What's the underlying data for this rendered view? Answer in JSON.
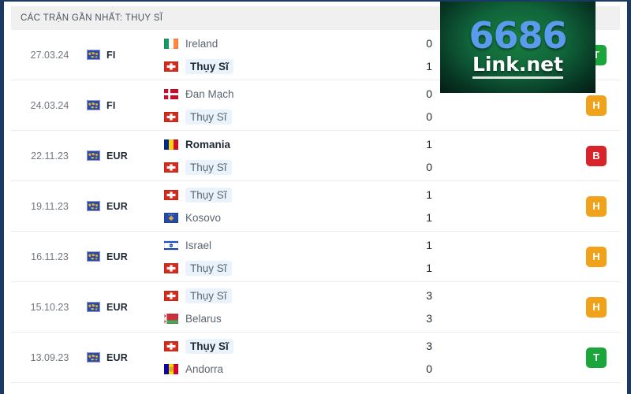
{
  "header": {
    "title": "CÁC TRẬN GẦN NHẤT: THỤY SĨ"
  },
  "colors": {
    "win_badge": "#1aa63a",
    "draw_badge": "#f0a21a",
    "loss_badge": "#d8232a",
    "header_bg": "#f0f0f0",
    "panel_border": "#1b3a63",
    "highlight": "#eaf3fb"
  },
  "watermark": {
    "number": "6686",
    "domain": "Link.net"
  },
  "matches": [
    {
      "date": "27.03.24",
      "competition": "FI",
      "competition_icon": "globe-icon",
      "home": {
        "name": "Ireland",
        "flag": "ireland-flag",
        "bold": false,
        "highlight": false
      },
      "away": {
        "name": "Thụy Sĩ",
        "flag": "switzerland-flag",
        "bold": true,
        "highlight": true
      },
      "home_score": "0",
      "away_score": "1",
      "result": "T",
      "result_color": "#1aa63a"
    },
    {
      "date": "24.03.24",
      "competition": "FI",
      "competition_icon": "globe-icon",
      "home": {
        "name": "Đan Mạch",
        "flag": "denmark-flag",
        "bold": false,
        "highlight": false
      },
      "away": {
        "name": "Thụy Sĩ",
        "flag": "switzerland-flag",
        "bold": false,
        "highlight": true
      },
      "home_score": "0",
      "away_score": "0",
      "result": "H",
      "result_color": "#f0a21a"
    },
    {
      "date": "22.11.23",
      "competition": "EUR",
      "competition_icon": "globe-icon",
      "home": {
        "name": "Romania",
        "flag": "romania-flag",
        "bold": true,
        "highlight": false
      },
      "away": {
        "name": "Thụy Sĩ",
        "flag": "switzerland-flag",
        "bold": false,
        "highlight": true
      },
      "home_score": "1",
      "away_score": "0",
      "result": "B",
      "result_color": "#d8232a"
    },
    {
      "date": "19.11.23",
      "competition": "EUR",
      "competition_icon": "globe-icon",
      "home": {
        "name": "Thụy Sĩ",
        "flag": "switzerland-flag",
        "bold": false,
        "highlight": true
      },
      "away": {
        "name": "Kosovo",
        "flag": "kosovo-flag",
        "bold": false,
        "highlight": false
      },
      "home_score": "1",
      "away_score": "1",
      "result": "H",
      "result_color": "#f0a21a"
    },
    {
      "date": "16.11.23",
      "competition": "EUR",
      "competition_icon": "globe-icon",
      "home": {
        "name": "Israel",
        "flag": "israel-flag",
        "bold": false,
        "highlight": false
      },
      "away": {
        "name": "Thụy Sĩ",
        "flag": "switzerland-flag",
        "bold": false,
        "highlight": true
      },
      "home_score": "1",
      "away_score": "1",
      "result": "H",
      "result_color": "#f0a21a"
    },
    {
      "date": "15.10.23",
      "competition": "EUR",
      "competition_icon": "globe-icon",
      "home": {
        "name": "Thụy Sĩ",
        "flag": "switzerland-flag",
        "bold": false,
        "highlight": true
      },
      "away": {
        "name": "Belarus",
        "flag": "belarus-flag",
        "bold": false,
        "highlight": false
      },
      "home_score": "3",
      "away_score": "3",
      "result": "H",
      "result_color": "#f0a21a"
    },
    {
      "date": "13.09.23",
      "competition": "EUR",
      "competition_icon": "globe-icon",
      "home": {
        "name": "Thụy Sĩ",
        "flag": "switzerland-flag",
        "bold": true,
        "highlight": true
      },
      "away": {
        "name": "Andorra",
        "flag": "andorra-flag",
        "bold": false,
        "highlight": false
      },
      "home_score": "3",
      "away_score": "0",
      "result": "T",
      "result_color": "#1aa63a"
    }
  ]
}
